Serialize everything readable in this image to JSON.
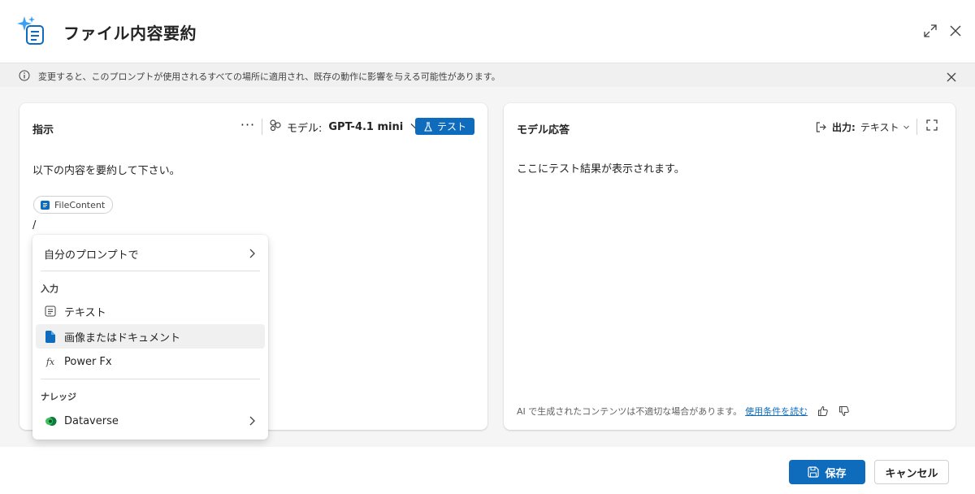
{
  "title": "ファイル内容要約",
  "banner": {
    "text": "変更すると、このプロンプトが使用されるすべての場所に適用され、既存の動作に影響を与える可能性があります。"
  },
  "instructions_panel": {
    "title": "指示",
    "more_label": "···",
    "model_label": "モデル:",
    "model_value": "GPT-4.1 mini",
    "test_label": "テスト",
    "prompt_text": "以下の内容を要約して下さい。",
    "chip_label": "FileContent",
    "slash_text": "/"
  },
  "response_panel": {
    "title": "モデル応答",
    "output_label": "出力:",
    "output_value": "テキスト",
    "placeholder": "ここにテスト結果が表示されます。",
    "footer_note": "AI で生成されたコンテンツは不適切な場合があります。",
    "footer_link": "使用条件を読む"
  },
  "dropdown": {
    "own_prompt": "自分のプロンプトで",
    "section_input": "入力",
    "item_text": "テキスト",
    "item_document": "画像またはドキュメント",
    "item_powerfx": "Power Fx",
    "section_knowledge": "ナレッジ",
    "item_dataverse": "Dataverse"
  },
  "footer": {
    "save_label": "保存",
    "cancel_label": "キャンセル"
  },
  "colors": {
    "accent": "#0f6cbd",
    "banner_bg": "#f0f0f0",
    "workspace_bg": "#f5f5f5"
  }
}
